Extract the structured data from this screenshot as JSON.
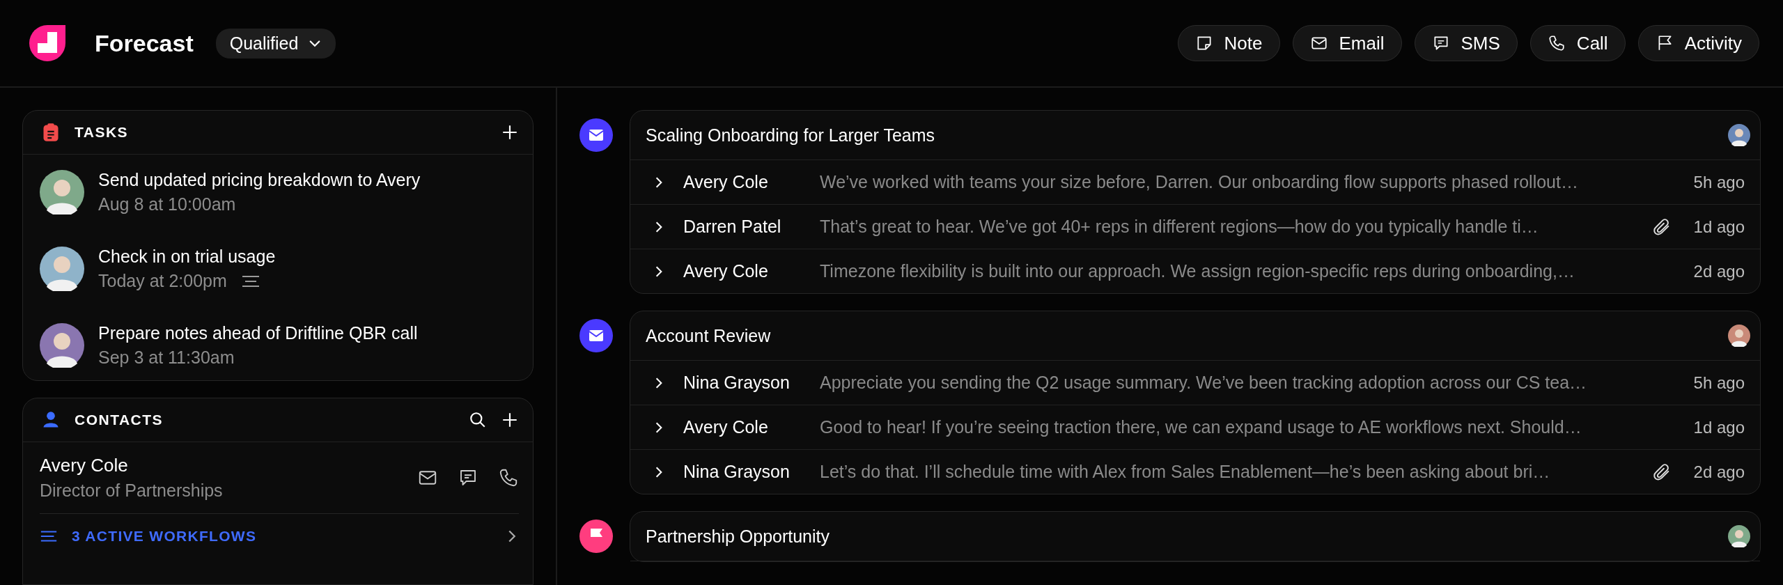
{
  "header": {
    "title": "Forecast",
    "stage": "Qualified"
  },
  "actions": [
    {
      "kind": "note",
      "label": "Note"
    },
    {
      "kind": "email",
      "label": "Email"
    },
    {
      "kind": "sms",
      "label": "SMS"
    },
    {
      "kind": "call",
      "label": "Call"
    },
    {
      "kind": "activity",
      "label": "Activity"
    }
  ],
  "tasks": {
    "title": "TASKS",
    "items": [
      {
        "title": "Send updated pricing breakdown to Avery",
        "due": "Aug 8 at 10:00am",
        "has_notes": false,
        "color": "#7fa98a"
      },
      {
        "title": "Check in on trial usage",
        "due": "Today at 2:00pm",
        "has_notes": true,
        "color": "#8fb3c9"
      },
      {
        "title": "Prepare notes ahead of Driftline QBR call",
        "due": "Sep 3 at 11:30am",
        "has_notes": false,
        "color": "#8a76b0"
      }
    ]
  },
  "contacts": {
    "title": "CONTACTS",
    "items": [
      {
        "name": "Avery Cole",
        "role": "Director of Partnerships"
      }
    ],
    "workflows": "3 ACTIVE WORKFLOWS"
  },
  "timeline": [
    {
      "kind": "email",
      "title": "Scaling Onboarding for Larger Teams",
      "color": "#6a88b8",
      "messages": [
        {
          "sender": "Avery Cole",
          "preview": "We’ve worked with teams your size before, Darren. Our onboarding flow supports phased rollout…",
          "attachment": false,
          "time": "5h ago"
        },
        {
          "sender": "Darren Patel",
          "preview": "That’s great to hear. We’ve got 40+ reps in different regions—how do you typically handle ti…",
          "attachment": true,
          "time": "1d ago"
        },
        {
          "sender": "Avery Cole",
          "preview": "Timezone flexibility is built into our approach. We assign region-specific reps during onboarding,…",
          "attachment": false,
          "time": "2d ago"
        }
      ]
    },
    {
      "kind": "email",
      "title": "Account Review",
      "color": "#c98a78",
      "messages": [
        {
          "sender": "Nina Grayson",
          "preview": "Appreciate you sending the Q2 usage summary. We’ve been tracking adoption across our CS tea…",
          "attachment": false,
          "time": "5h ago"
        },
        {
          "sender": "Avery Cole",
          "preview": "Good to hear! If you’re seeing traction there, we can expand usage to AE workflows next. Should…",
          "attachment": false,
          "time": "1d ago"
        },
        {
          "sender": "Nina Grayson",
          "preview": "Let’s do that. I’ll schedule time with Alex from Sales Enablement—he’s been asking about bri…",
          "attachment": true,
          "time": "2d ago"
        }
      ]
    },
    {
      "kind": "activity",
      "title": "Partnership Opportunity",
      "color": "#7fa98a"
    }
  ]
}
